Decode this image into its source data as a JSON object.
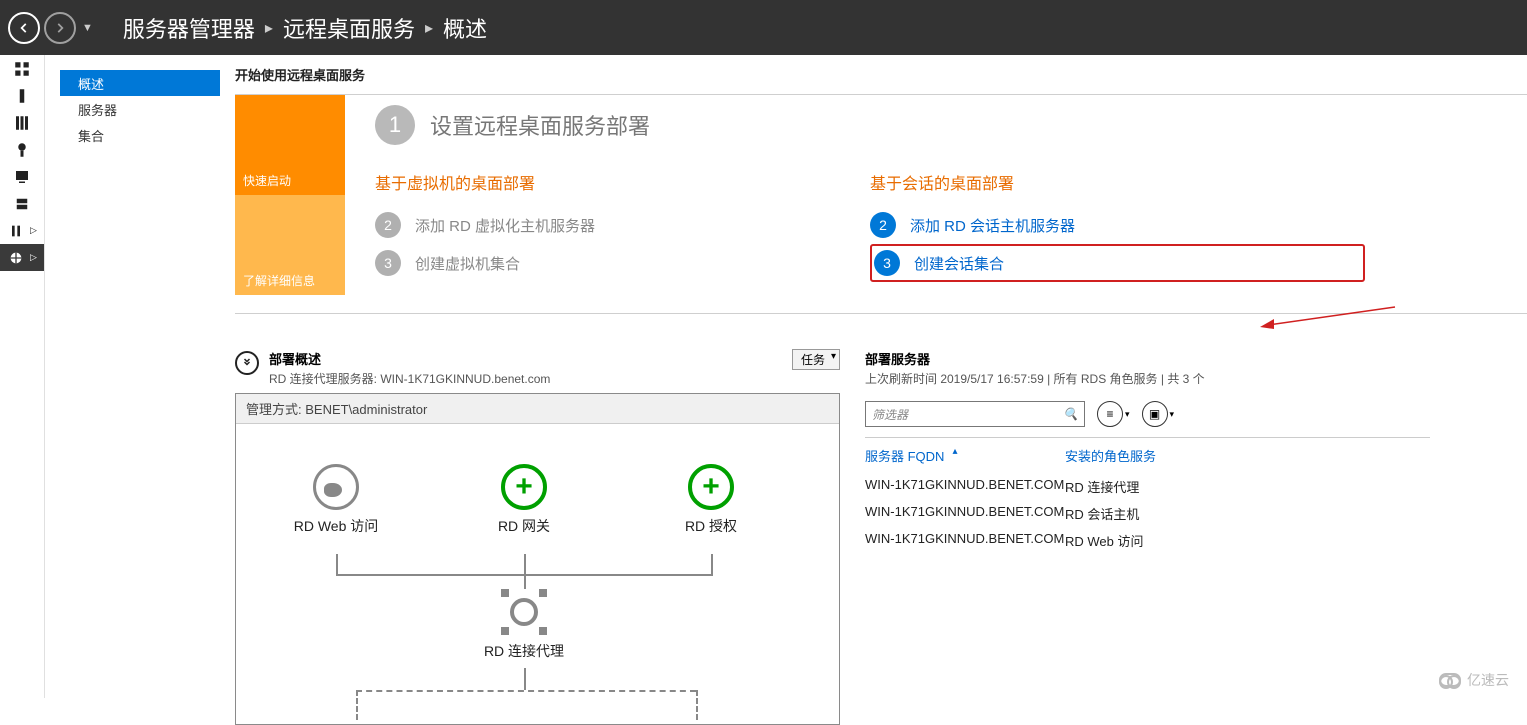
{
  "breadcrumb": {
    "part1": "服务器管理器",
    "part2": "远程桌面服务",
    "part3": "概述"
  },
  "sidenav": {
    "overview": "概述",
    "servers": "服务器",
    "collections": "集合"
  },
  "getting_started": {
    "section_title": "开始使用远程桌面服务",
    "tile_quickstart": "快速启动",
    "tile_learnmore": "了解详细信息",
    "head_num": "1",
    "head_text": "设置远程桌面服务部署",
    "vm_col_title": "基于虚拟机的桌面部署",
    "vm_step2": "添加 RD 虚拟化主机服务器",
    "vm_step3": "创建虚拟机集合",
    "sess_col_title": "基于会话的桌面部署",
    "sess_step2": "添加 RD 会话主机服务器",
    "sess_step3": "创建会话集合"
  },
  "overview_box": {
    "title": "部署概述",
    "subtitle": "RD 连接代理服务器: WIN-1K71GKINNUD.benet.com",
    "tasks_label": "任务",
    "mgmt_label": "管理方式: BENET\\administrator",
    "node_web": "RD Web 访问",
    "node_gateway": "RD 网关",
    "node_license": "RD 授权",
    "node_broker": "RD 连接代理"
  },
  "servers_box": {
    "title": "部署服务器",
    "subtitle": "上次刷新时间 2019/5/17 16:57:59 | 所有 RDS 角色服务  | 共 3 个",
    "filter_placeholder": "筛选器",
    "col_fqdn": "服务器 FQDN",
    "col_role": "安装的角色服务",
    "rows": [
      {
        "fqdn": "WIN-1K71GKINNUD.BENET.COM",
        "role": "RD 连接代理"
      },
      {
        "fqdn": "WIN-1K71GKINNUD.BENET.COM",
        "role": "RD 会话主机"
      },
      {
        "fqdn": "WIN-1K71GKINNUD.BENET.COM",
        "role": "RD Web 访问"
      }
    ]
  },
  "watermark": "亿速云"
}
